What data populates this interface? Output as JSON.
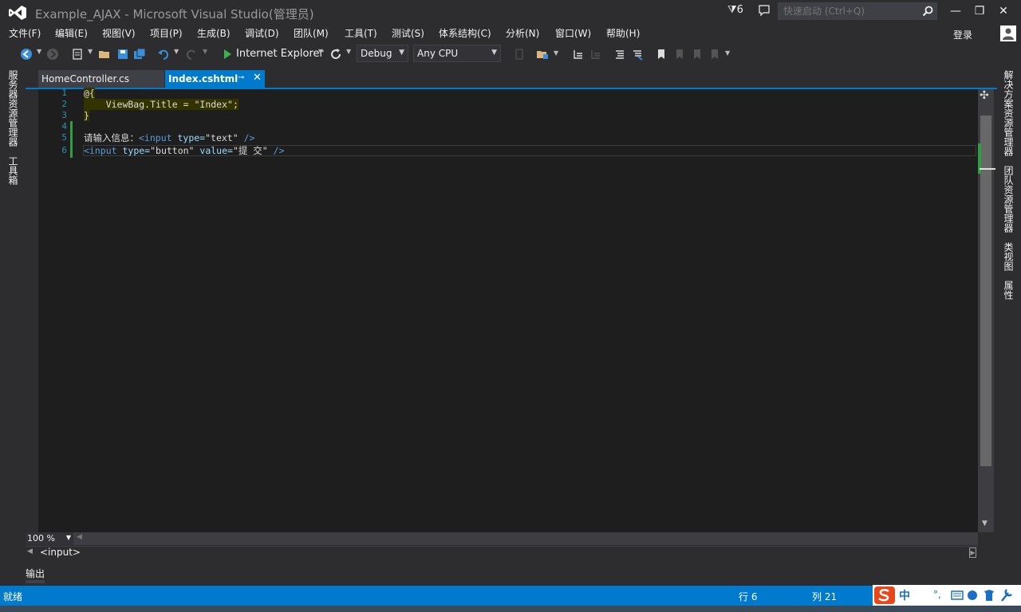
{
  "window": {
    "title": "Example_AJAX - Microsoft Visual Studio(管理员)",
    "notification_count": "6",
    "quick_launch_placeholder": "快速启动 (Ctrl+Q)",
    "minimize": "—",
    "maximize": "❐",
    "close": "✕"
  },
  "menu": {
    "items": [
      "文件(F)",
      "编辑(E)",
      "视图(V)",
      "项目(P)",
      "生成(B)",
      "调试(D)",
      "团队(M)",
      "工具(T)",
      "测试(S)",
      "体系结构(C)",
      "分析(N)",
      "窗口(W)",
      "帮助(H)"
    ],
    "login": "登录"
  },
  "toolbar": {
    "run_target": "Internet Explorer",
    "configuration": "Debug",
    "platform": "Any CPU"
  },
  "left_panels": [
    "服务器资源管理器",
    "工具箱"
  ],
  "right_panels": [
    "解决方案资源管理器",
    "团队资源管理器",
    "类视图",
    "属性"
  ],
  "tabs": [
    {
      "label": "HomeController.cs",
      "active": false
    },
    {
      "label": "Index.cshtml",
      "active": true
    }
  ],
  "editor": {
    "line_numbers": [
      "1",
      "2",
      "3",
      "4",
      "5",
      "6"
    ],
    "lines": {
      "l1": "@{",
      "l2_pre": "    ViewBag.Title = ",
      "l2_str": "\"Index\"",
      "l2_post": ";",
      "l3": "}",
      "l5_text": "请输入信息：",
      "l5_tag_open": "<input ",
      "l5_attr": "type=",
      "l5_val": "\"text\"",
      "l5_close": " />",
      "l6_tag_open": "<input ",
      "l6_attr1": "type=",
      "l6_val1": "\"button\"",
      "l6_attr2": " value=",
      "l6_val2": "\"提 交\"",
      "l6_close": " />"
    },
    "zoom": "100 %",
    "breadcrumb": "<input>"
  },
  "output_tab": "输出",
  "status": {
    "ready": "就绪",
    "row": "行 6",
    "col": "列 21"
  },
  "colors": {
    "accent": "#007acc",
    "editor_bg": "#1e1e1e",
    "keyword": "#569cd6",
    "string": "#d69d85"
  }
}
